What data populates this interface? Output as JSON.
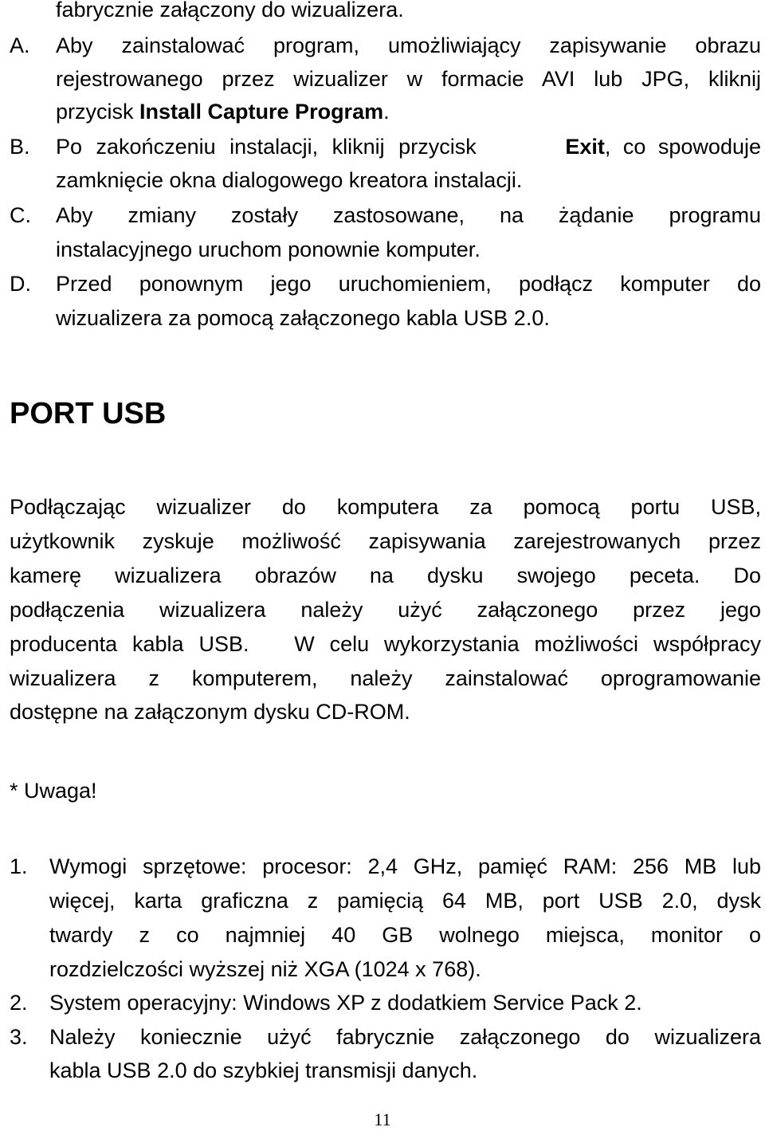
{
  "intro_tail": "fabrycznie załączony do wizualizera.",
  "steps": [
    {
      "marker": "A.",
      "lines": [
        "Aby zainstalować program, umożliwiający zapisywanie obrazu",
        "rejestrowanego przez wizualizer w formacie AVI lub JPG, kliknij"
      ],
      "last_prefix": "przycisk ",
      "last_bold": "Install Capture Program",
      "last_suffix": "."
    },
    {
      "marker": "B.",
      "line1_prefix": "Po zakończeniu instalacji, kliknij przycisk ",
      "line1_bold": "Exit",
      "line1_suffix": ", co spowoduje",
      "line2": "zamknięcie okna dialogowego kreatora instalacji."
    },
    {
      "marker": "C.",
      "line1": "Aby zmiany zostały zastosowane, na żądanie programu",
      "line2": "instalacyjnego uruchom ponownie komputer."
    },
    {
      "marker": "D.",
      "line1": "Przed ponownym jego uruchomieniem, podłącz komputer do",
      "line2": "wizualizera za pomocą załączonego kabla USB 2.0."
    }
  ],
  "section": {
    "heading": "PORT USB",
    "paragraph_lines": [
      "Podłączając wizualizer do komputera za pomocą portu USB,",
      "użytkownik zyskuje możliwość zapisywania zarejestrowanych przez",
      "kamerę wizualizera obrazów na dysku swojego peceta. Do",
      "podłączenia wizualizera należy użyć załączonego przez jego",
      "producenta kabla USB.   W celu wykorzystania możliwości współpracy",
      "wizualizera z komputerem, należy zainstalować oprogramowanie",
      "dostępne na załączonym dysku CD-ROM."
    ],
    "note_label": "* Uwaga!",
    "requirements": [
      {
        "marker": "1.",
        "lines": [
          "Wymogi sprzętowe: procesor: 2,4 GHz, pamięć RAM: 256 MB lub",
          "więcej, karta graficzna z pamięcią 64 MB, port USB 2.0, dysk",
          "twardy z co najmniej 40 GB wolnego miejsca, monitor o",
          "rozdzielczości wyższej niż XGA (1024 x 768)."
        ]
      },
      {
        "marker": "2.",
        "lines": [
          "System operacyjny: Windows XP z dodatkiem Service Pack 2."
        ]
      },
      {
        "marker": "3.",
        "lines": [
          "Należy koniecznie użyć fabrycznie załączonego do wizualizera",
          "kabla USB 2.0 do szybkiej transmisji danych."
        ]
      }
    ]
  },
  "page_number": "11"
}
